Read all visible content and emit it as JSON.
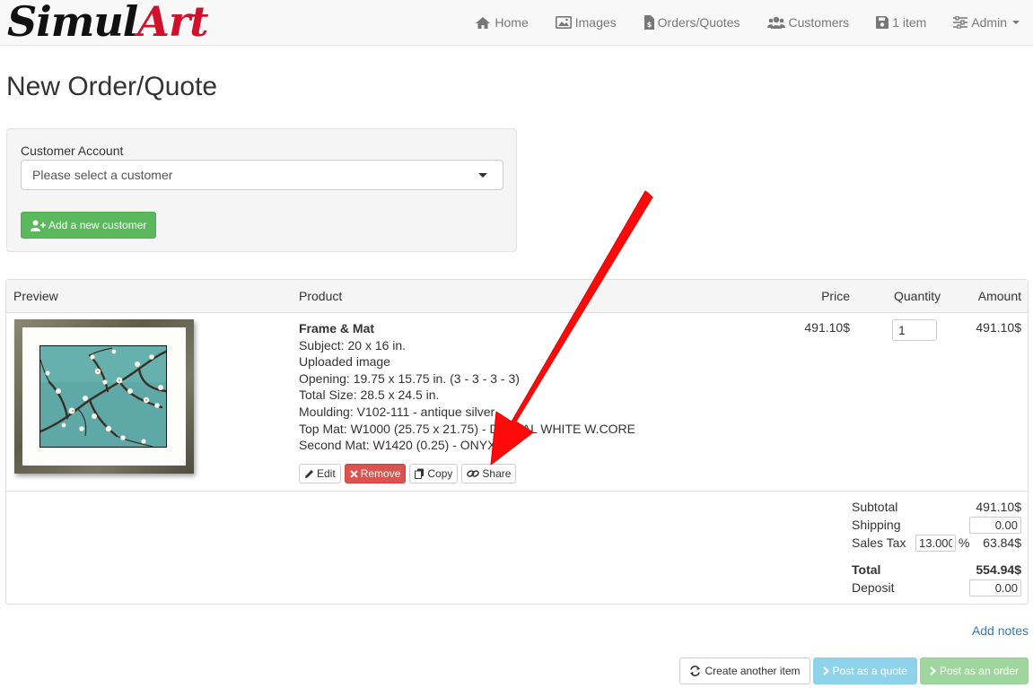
{
  "brand": {
    "part1": "Simul",
    "part2": "Art"
  },
  "nav": {
    "home": "Home",
    "images": "Images",
    "orders": "Orders/Quotes",
    "customers": "Customers",
    "cart": "1 item",
    "admin": "Admin"
  },
  "page_title": "New Order/Quote",
  "customer": {
    "label": "Customer Account",
    "placeholder": "Please select a customer",
    "add_button": "Add a new customer"
  },
  "table": {
    "headers": {
      "preview": "Preview",
      "product": "Product",
      "price": "Price",
      "quantity": "Quantity",
      "amount": "Amount"
    },
    "item": {
      "name": "Frame & Mat",
      "details": [
        "Subject: 20 x 16 in.",
        "Uploaded image",
        "Opening: 19.75 x 15.75 in. (3 - 3 - 3 - 3)",
        "Total Size: 28.5 x 24.5 in.",
        "Moulding: V102-111 - antique silver",
        "Top Mat: W1000 (25.75 x 21.75) - DIGITAL WHITE W.CORE",
        "Second Mat: W1420 (0.25) - ONYX"
      ],
      "price": "491.10$",
      "quantity": "1",
      "amount": "491.10$",
      "actions": {
        "edit": "Edit",
        "remove": "Remove",
        "copy": "Copy",
        "share": "Share"
      }
    }
  },
  "totals": {
    "subtotal_label": "Subtotal",
    "subtotal": "491.10$",
    "shipping_label": "Shipping",
    "shipping": "0.00",
    "tax_label": "Sales Tax",
    "tax_rate": "13.000",
    "tax_percent_sign": "%",
    "tax_amount": "63.84$",
    "total_label": "Total",
    "total": "554.94$",
    "deposit_label": "Deposit",
    "deposit": "0.00"
  },
  "add_notes": "Add notes",
  "buttons": {
    "create_another": "Create another item",
    "post_quote": "Post as a quote",
    "post_order": "Post as an order"
  },
  "colors": {
    "brand_red": "#d0112b",
    "success": "#5cb85c",
    "danger": "#d9534f",
    "link": "#337ab7",
    "annotation_arrow": "#ff0a0a"
  }
}
